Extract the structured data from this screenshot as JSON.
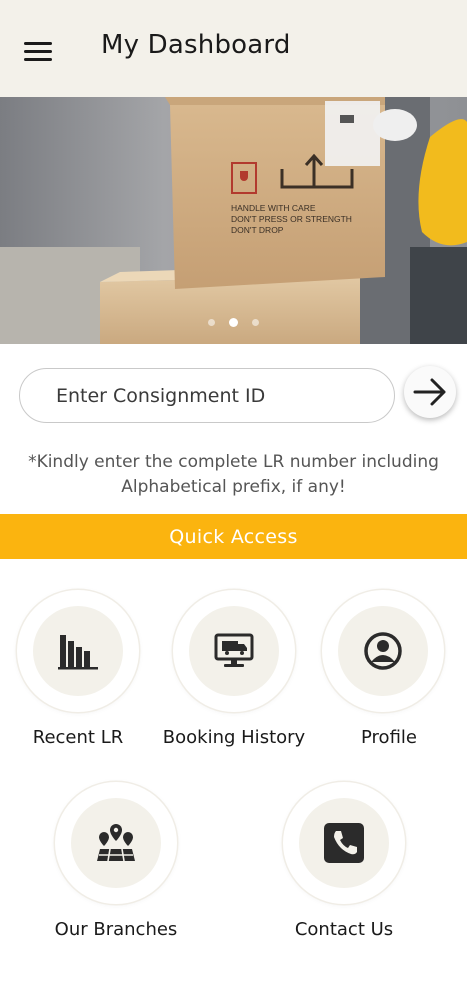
{
  "app_bar": {
    "title": "My Dashboard",
    "menu_icon": "menu-icon"
  },
  "carousel": {
    "slide_count": 3,
    "active_index": 1,
    "box_text": "HANDLE WITH CARE\nDON'T PRESS OR STRENGTH\nDON'T DROP"
  },
  "search": {
    "placeholder": "Enter Consignment ID",
    "value": "",
    "submit_icon": "arrow-right-icon"
  },
  "helper_text": "*Kindly enter the complete LR number including Alphabetical prefix, if any!",
  "quick_access": {
    "title": "Quick Access",
    "accent": "#fbb40f",
    "items": [
      {
        "label": "Recent LR",
        "icon": "bar-chart-icon"
      },
      {
        "label": "Booking History",
        "icon": "delivery-truck-monitor-icon"
      },
      {
        "label": "Profile",
        "icon": "user-circle-icon"
      },
      {
        "label": "Our Branches",
        "icon": "map-pins-icon"
      },
      {
        "label": "Contact Us",
        "icon": "phone-icon"
      }
    ]
  }
}
